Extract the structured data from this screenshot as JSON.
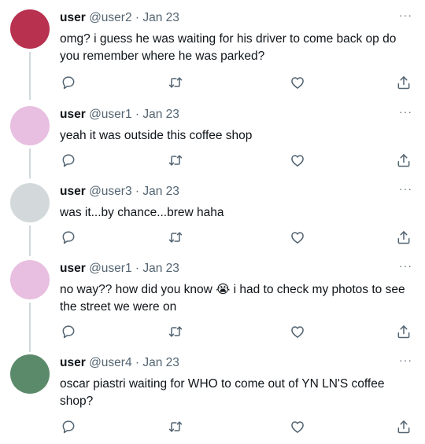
{
  "tweets": [
    {
      "name": "user",
      "handle": "@user2",
      "dot": "·",
      "date": "Jan 23",
      "text": "omg? i guess he was waiting for his driver to come back op do you remember where he was parked?",
      "avatar_color": "#b8314f"
    },
    {
      "name": "user",
      "handle": "@user1",
      "dot": "·",
      "date": "Jan 23",
      "text": "yeah it was outside this coffee shop",
      "avatar_color": "#e8bfe0"
    },
    {
      "name": "user",
      "handle": "@user3",
      "dot": "·",
      "date": "Jan 23",
      "text": "was it...by chance...brew haha",
      "avatar_color": "#d3d9db"
    },
    {
      "name": "user",
      "handle": "@user1",
      "dot": "·",
      "date": "Jan 23",
      "text": "no way?? how did you know 😭 i had to check my photos to see the street we were on",
      "avatar_color": "#e8bfe0"
    },
    {
      "name": "user",
      "handle": "@user4",
      "dot": "·",
      "date": "Jan 23",
      "text": "oscar piastri waiting for WHO to come out of YN LN'S coffee shop?",
      "avatar_color": "#5b8a6a"
    }
  ],
  "more_label": "···",
  "icons": {
    "reply": "reply-icon",
    "retweet": "retweet-icon",
    "like": "like-icon",
    "share": "share-icon"
  },
  "colors": {
    "text": "#0f1419",
    "secondary": "#536471",
    "thread_line": "#cfd9de"
  }
}
